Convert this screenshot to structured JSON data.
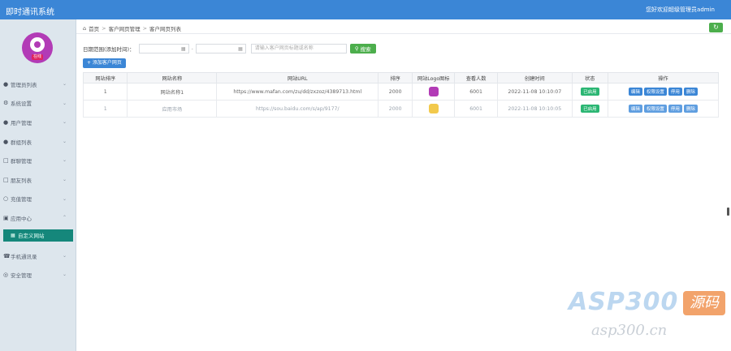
{
  "app": {
    "title": "即时通讯系统",
    "welcome": "您好欢迎超级管理员admin"
  },
  "sidebar": {
    "avatar_tag": "在线",
    "items": [
      {
        "label": "管理员列表",
        "icon": "user-icon"
      },
      {
        "label": "系统设置",
        "icon": "gear-icon"
      },
      {
        "label": "用户管理",
        "icon": "user-icon"
      },
      {
        "label": "群组列表",
        "icon": "group-icon"
      },
      {
        "label": "群聊管理",
        "icon": "chat-icon"
      },
      {
        "label": "朋友列表",
        "icon": "friends-icon"
      },
      {
        "label": "充值管理",
        "icon": "wallet-icon"
      },
      {
        "label": "应用中心",
        "icon": "apps-icon"
      }
    ],
    "active_sub": {
      "label": "自定义网站",
      "icon": "globe-icon"
    },
    "items_after": [
      {
        "label": "手机通讯录",
        "icon": "phone-icon"
      },
      {
        "label": "安全管理",
        "icon": "shield-icon"
      }
    ]
  },
  "breadcrumb": {
    "home": "首页",
    "level1": "客户网页管理",
    "level2": "客户网页列表"
  },
  "filter": {
    "label": "日期范围(添加时间)：",
    "date_start_placeholder": "",
    "date_end_placeholder": "",
    "search_placeholder": "请输入客户网页标题或名称",
    "search_button": "搜索"
  },
  "add_button": "+ 添加客户网页",
  "table": {
    "headers": [
      "网站排序",
      "网站名称",
      "网站URL",
      "排序",
      "网站Logo图标",
      "查看人数",
      "创建时间",
      "状态",
      "操作"
    ],
    "rows": [
      {
        "sort": "1",
        "name": "网站名称1",
        "url": "https://www.mafan.com/zu/dd/zxzoz/4389713.html",
        "order": "2000",
        "logo_color": "#b23bb6",
        "views": "6001",
        "created": "2022-11-08 10:10:07",
        "status": "已启用",
        "ops": [
          "编辑",
          "权限设置",
          "停用",
          "删除"
        ]
      },
      {
        "sort": "1",
        "name": "应用市场",
        "url": "https://sou.baidu.com/s/ap/9177/",
        "order": "2000",
        "logo_color": "#f2c94c",
        "views": "6001",
        "created": "2022-11-08 10:10:05",
        "status": "已启用",
        "ops": [
          "编辑",
          "权限设置",
          "停用",
          "删除"
        ]
      }
    ]
  },
  "watermark": {
    "brand": "ASP300",
    "yuan": "源码",
    "url": "asp300.cn"
  }
}
